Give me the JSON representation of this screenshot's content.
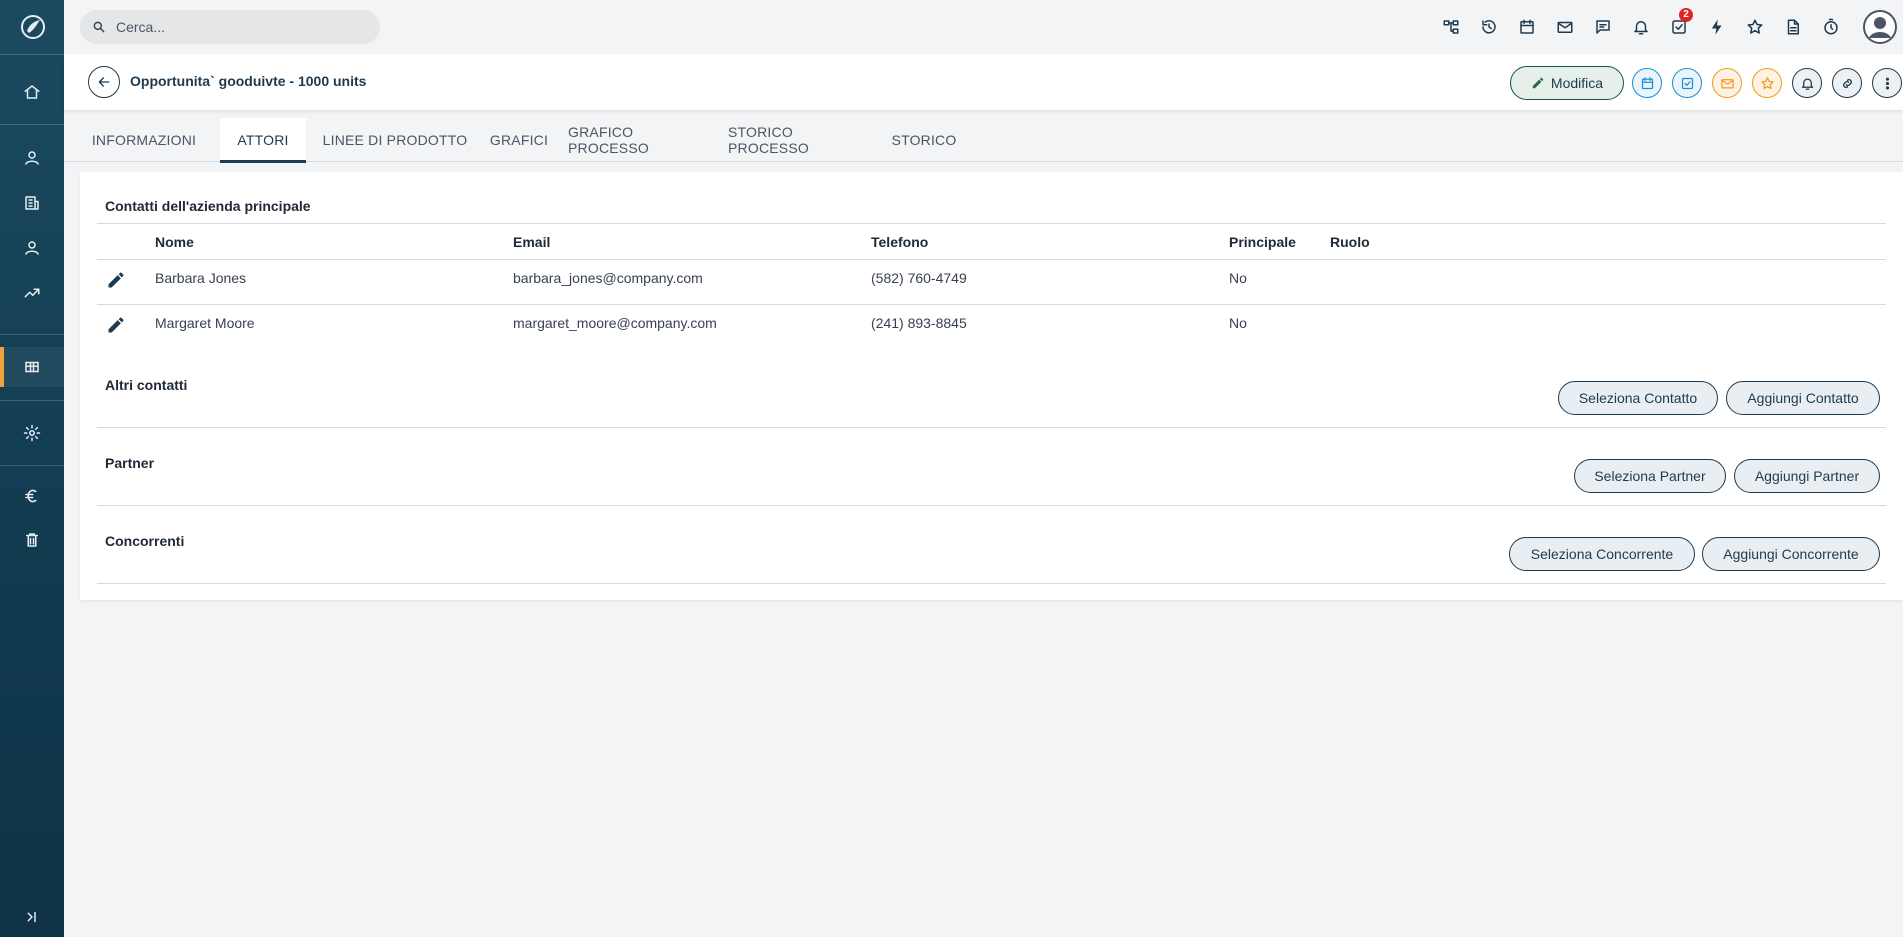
{
  "search": {
    "placeholder": "Cerca..."
  },
  "topbar": {
    "notification_badge": "2"
  },
  "record": {
    "title": "Opportunita` gooduivte - 1000 units",
    "edit_label": "Modifica"
  },
  "tabs": [
    {
      "label": "INFORMAZIONI"
    },
    {
      "label": "ATTORI"
    },
    {
      "label": "LINEE DI PRODOTTO"
    },
    {
      "label": "GRAFICI"
    },
    {
      "label": "GRAFICO PROCESSO"
    },
    {
      "label": "STORICO PROCESSO"
    },
    {
      "label": "STORICO"
    }
  ],
  "main_contacts": {
    "title": "Contatti dell'azienda principale",
    "headers": {
      "name": "Nome",
      "email": "Email",
      "phone": "Telefono",
      "primary": "Principale",
      "role": "Ruolo"
    },
    "rows": [
      {
        "name": "Barbara Jones",
        "email": "barbara_jones@company.com",
        "phone": "(582) 760-4749",
        "primary": "No",
        "role": ""
      },
      {
        "name": "Margaret Moore",
        "email": "margaret_moore@company.com",
        "phone": "(241) 893-8845",
        "primary": "No",
        "role": ""
      }
    ]
  },
  "other_contacts": {
    "title": "Altri contatti",
    "select_label": "Seleziona Contatto",
    "add_label": "Aggiungi Contatto"
  },
  "partners": {
    "title": "Partner",
    "select_label": "Seleziona Partner",
    "add_label": "Aggiungi Partner"
  },
  "competitors": {
    "title": "Concorrenti",
    "select_label": "Seleziona Concorrente",
    "add_label": "Aggiungi Concorrente"
  },
  "colors": {
    "primary": "#1e3a4f",
    "sidebar": "#133d52",
    "accent": "#f0a23a",
    "badge": "#e02424"
  }
}
